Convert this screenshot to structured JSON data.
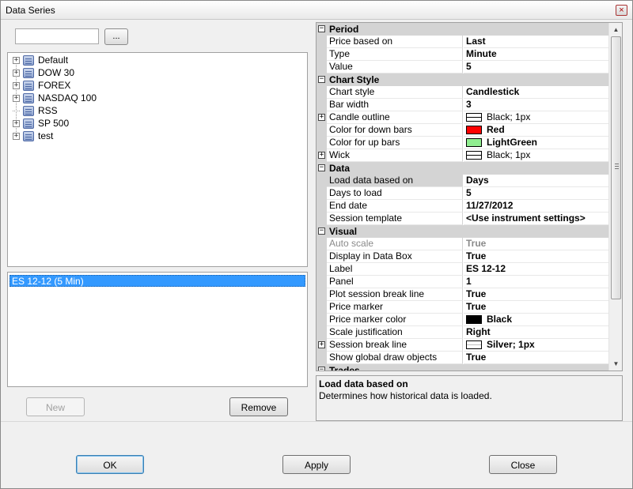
{
  "window": {
    "title": "Data Series",
    "close_glyph": "×"
  },
  "left": {
    "search_value": "",
    "browse_label": "...",
    "tree": [
      {
        "label": "Default",
        "expandable": true
      },
      {
        "label": "DOW 30",
        "expandable": true
      },
      {
        "label": "FOREX",
        "expandable": true
      },
      {
        "label": "NASDAQ 100",
        "expandable": true
      },
      {
        "label": "RSS",
        "expandable": false
      },
      {
        "label": "SP 500",
        "expandable": true
      },
      {
        "label": "test",
        "expandable": true
      }
    ],
    "series": [
      "ES 12-12 (5 Min)"
    ],
    "new_label": "New",
    "remove_label": "Remove"
  },
  "grid": {
    "categories": {
      "period": "Period",
      "chart_style": "Chart Style",
      "data": "Data",
      "visual": "Visual",
      "trades": "Trades"
    },
    "period": {
      "price_based_on": {
        "name": "Price based on",
        "value": "Last"
      },
      "type": {
        "name": "Type",
        "value": "Minute"
      },
      "value": {
        "name": "Value",
        "value": "5"
      }
    },
    "chart_style": {
      "chart_style": {
        "name": "Chart style",
        "value": "Candlestick"
      },
      "bar_width": {
        "name": "Bar width",
        "value": "3"
      },
      "candle_outline": {
        "name": "Candle outline",
        "value": "Black; 1px"
      },
      "color_down": {
        "name": "Color for down bars",
        "value": "Red",
        "color": "#ff0000"
      },
      "color_up": {
        "name": "Color for up bars",
        "value": "LightGreen",
        "color": "#90ee90"
      },
      "wick": {
        "name": "Wick",
        "value": "Black; 1px"
      }
    },
    "data": {
      "load_based_on": {
        "name": "Load data based on",
        "value": "Days"
      },
      "days_to_load": {
        "name": "Days to load",
        "value": "5"
      },
      "end_date": {
        "name": "End date",
        "value": "11/27/2012"
      },
      "session_template": {
        "name": "Session template",
        "value": "<Use instrument settings>"
      }
    },
    "visual": {
      "auto_scale": {
        "name": "Auto scale",
        "value": "True"
      },
      "display_in_data_box": {
        "name": "Display in Data Box",
        "value": "True"
      },
      "label": {
        "name": "Label",
        "value": "ES 12-12"
      },
      "panel": {
        "name": "Panel",
        "value": "1"
      },
      "plot_session_break": {
        "name": "Plot session break line",
        "value": "True"
      },
      "price_marker": {
        "name": "Price marker",
        "value": "True"
      },
      "price_marker_color": {
        "name": "Price marker color",
        "value": "Black",
        "color": "#000000"
      },
      "scale_justification": {
        "name": "Scale justification",
        "value": "Right"
      },
      "session_break_line": {
        "name": "Session break line",
        "value": "Silver; 1px"
      },
      "show_global_draw": {
        "name": "Show global draw objects",
        "value": "True"
      }
    }
  },
  "help": {
    "title": "Load data based on",
    "text": "Determines how historical data is loaded."
  },
  "footer": {
    "ok_label": "OK",
    "apply_label": "Apply",
    "close_label": "Close"
  }
}
